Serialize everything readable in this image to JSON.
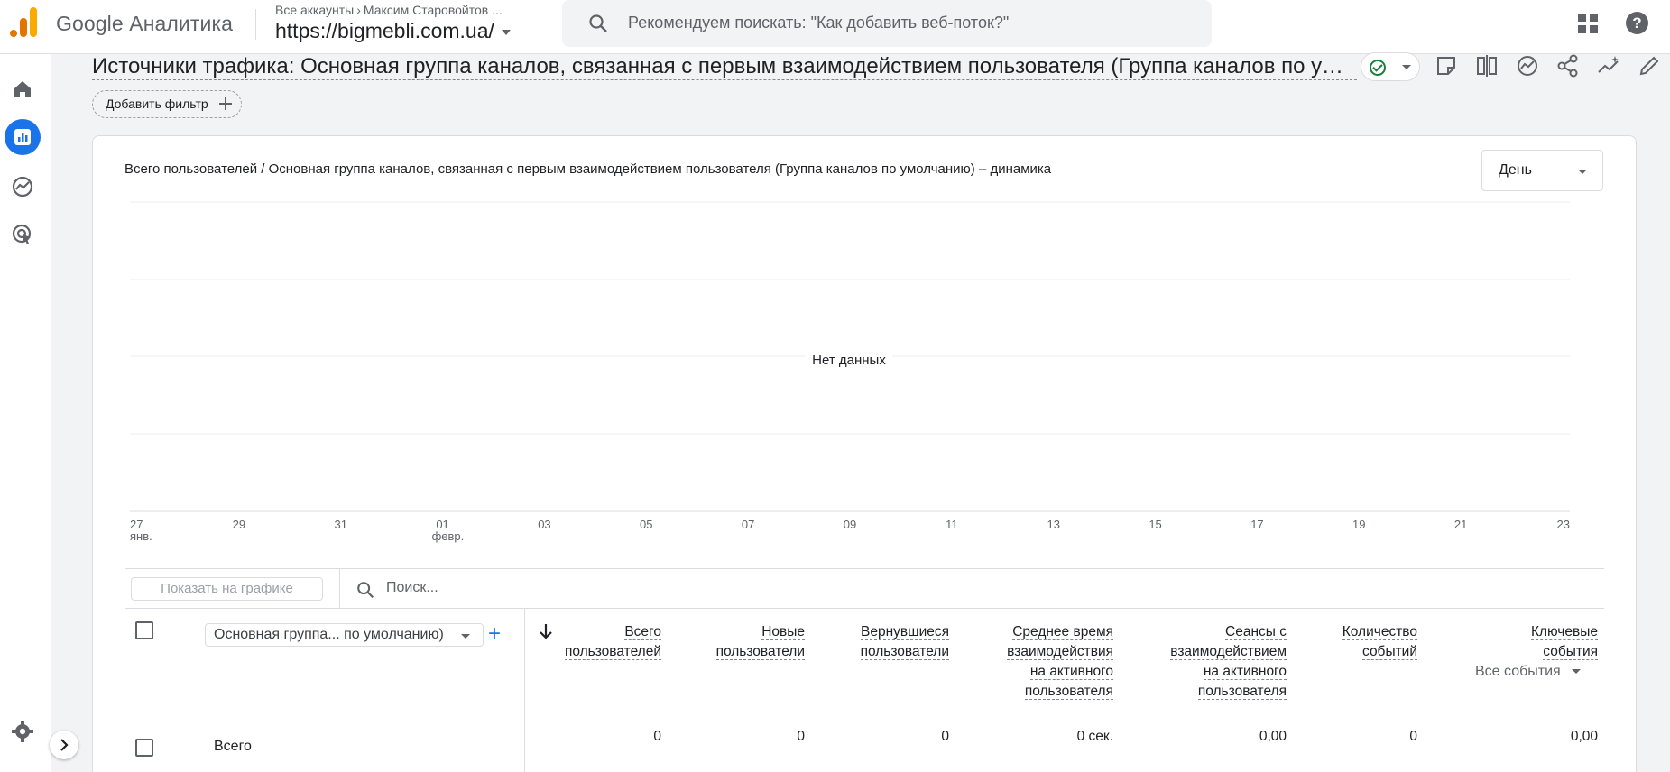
{
  "app": {
    "brand": "Google Аналитика",
    "breadcrumb_accounts": "Все аккаунты",
    "breadcrumb_account": "Максим Старовойтов ...",
    "property": "https://bigmebli.com.ua/"
  },
  "search": {
    "placeholder": "Рекомендуем поискать: \"Как добавить веб-поток?\""
  },
  "report": {
    "title": "Источники трафика: Основная группа каналов, связанная с первым взаимодействием пользователя (Группа каналов по умолчанию)",
    "add_filter": "Добавить фильтр"
  },
  "chart_data": {
    "type": "line",
    "title": "Всего пользователей / Основная группа каналов, связанная с первым взаимодействием пользователя (Группа каналов по умолчанию) – динамика",
    "period": "День",
    "empty_message": "Нет данных",
    "x_ticks": [
      {
        "day": "27",
        "month": "янв."
      },
      {
        "day": "29",
        "month": ""
      },
      {
        "day": "31",
        "month": ""
      },
      {
        "day": "01",
        "month": "февр."
      },
      {
        "day": "03",
        "month": ""
      },
      {
        "day": "05",
        "month": ""
      },
      {
        "day": "07",
        "month": ""
      },
      {
        "day": "09",
        "month": ""
      },
      {
        "day": "11",
        "month": ""
      },
      {
        "day": "13",
        "month": ""
      },
      {
        "day": "15",
        "month": ""
      },
      {
        "day": "17",
        "month": ""
      },
      {
        "day": "19",
        "month": ""
      },
      {
        "day": "21",
        "month": ""
      },
      {
        "day": "23",
        "month": ""
      }
    ],
    "series": [],
    "grid": true
  },
  "table": {
    "show_on_chart": "Показать на графике",
    "search_placeholder": "Поиск...",
    "dimension": "Основная группа... по умолчанию)",
    "add_dimension": "+",
    "headers": [
      {
        "line1": "Всего",
        "line2": "пользователей",
        "line3": "",
        "line4": ""
      },
      {
        "line1": "Новые",
        "line2": "пользователи",
        "line3": "",
        "line4": ""
      },
      {
        "line1": "Вернувшиеся",
        "line2": "пользователи",
        "line3": "",
        "line4": ""
      },
      {
        "line1": "Среднее время",
        "line2": "взаимодействия",
        "line3": "на активного",
        "line4": "пользователя"
      },
      {
        "line1": "Сеансы с",
        "line2": "взаимодействием",
        "line3": "на активного",
        "line4": "пользователя"
      },
      {
        "line1": "Количество",
        "line2": "событий",
        "line3": "",
        "line4": ""
      },
      {
        "line1": "Ключевые",
        "line2": "события",
        "line3": "",
        "line4": ""
      }
    ],
    "event_selector": "Все события",
    "total_label": "Всего",
    "totals": [
      "0",
      "0",
      "0",
      "0 сек.",
      "0,00",
      "0",
      "0,00"
    ]
  },
  "colors": {
    "accent": "#1a73e8",
    "logo_orange": "#f9ab00",
    "logo_dark": "#e37400",
    "success": "#188038"
  }
}
